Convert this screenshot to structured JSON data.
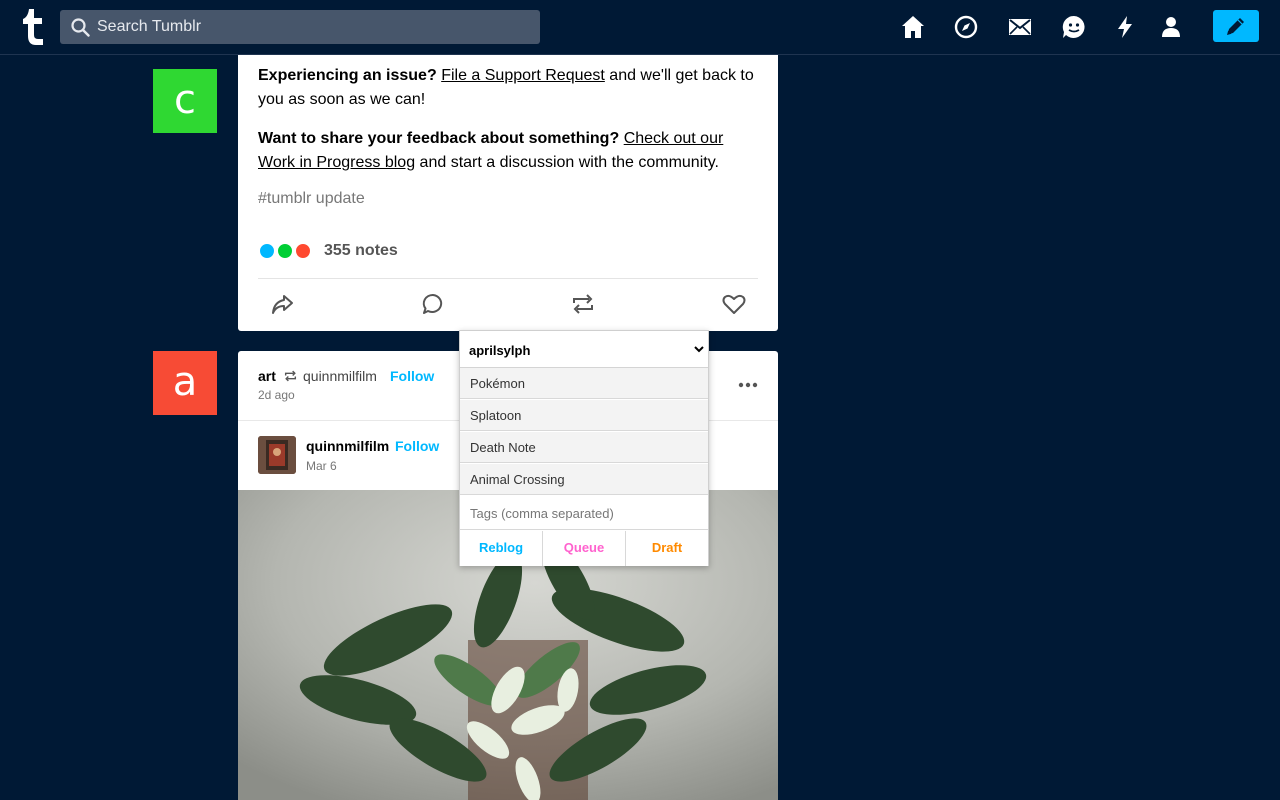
{
  "search": {
    "placeholder": "Search Tumblr"
  },
  "nav_icons": [
    "home-icon",
    "explore-icon",
    "inbox-icon",
    "messaging-icon",
    "activity-icon",
    "account-icon",
    "compose-icon"
  ],
  "colors": {
    "background": "#001935",
    "accent_blue": "#00b8ff",
    "avatar_c": "#2fd832",
    "avatar_a": "#f74b35",
    "queue_pink": "#ff62ce",
    "draft_orange": "#ff8a00"
  },
  "post1": {
    "avatar_letter": "c",
    "para1": {
      "bold": "Experiencing an issue?",
      "link": "File a Support Request",
      "rest": " and we'll get back to you as soon as we can!"
    },
    "para2": {
      "bold": "Want to share your feedback about something?",
      "link": "Check out our Work in Progress blog",
      "rest": " and start a discussion with the community."
    },
    "tag": "#tumblr update",
    "notes": "355 notes"
  },
  "post2": {
    "avatar_letter": "a",
    "blog": "art",
    "source_blog": "quinnmilfilm",
    "follow_label": "Follow",
    "time": "2d ago",
    "sub_blog": "quinnmilfilm",
    "sub_follow_label": "Follow",
    "sub_date": "Mar 6"
  },
  "reblog_popover": {
    "selected_blog": "aprilsylph",
    "suggested_tags": [
      "Pokémon",
      "Splatoon",
      "Death Note",
      "Animal Crossing"
    ],
    "tags_placeholder": "Tags (comma separated)",
    "buttons": {
      "reblog": "Reblog",
      "queue": "Queue",
      "draft": "Draft"
    }
  }
}
